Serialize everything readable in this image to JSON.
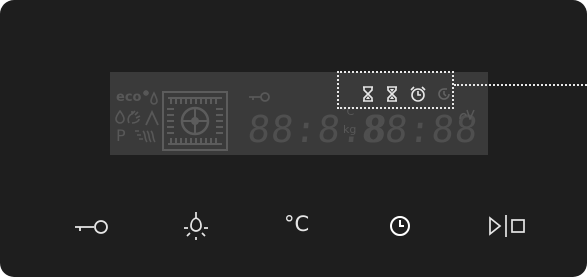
{
  "panel": {
    "display": {
      "modes": {
        "eco": "eco",
        "program": "P"
      },
      "units": {
        "temperature": "°C",
        "weight": "kg"
      },
      "readouts": {
        "left": "88:8.8",
        "right": "88:88"
      },
      "icons": [
        "drop-icon",
        "steam-icon",
        "thaw-icon",
        "preheat-icon",
        "grill-icon",
        "fan-oven-icon",
        "key-lock-icon",
        "timer-icon",
        "end-timer-icon",
        "alarm-clock-icon",
        "time-adjust-icon",
        "signal-icon"
      ]
    },
    "highlight_color": "#e8e8e8",
    "buttons": [
      {
        "name": "key-lock-button",
        "icon": "key-lock-icon"
      },
      {
        "name": "light-button",
        "icon": "light-bulb-icon"
      },
      {
        "name": "temperature-button",
        "icon": "temperature-icon",
        "label": "°C"
      },
      {
        "name": "clock-button",
        "icon": "clock-icon"
      },
      {
        "name": "start-stop-button",
        "icon": "start-stop-icon"
      }
    ]
  }
}
